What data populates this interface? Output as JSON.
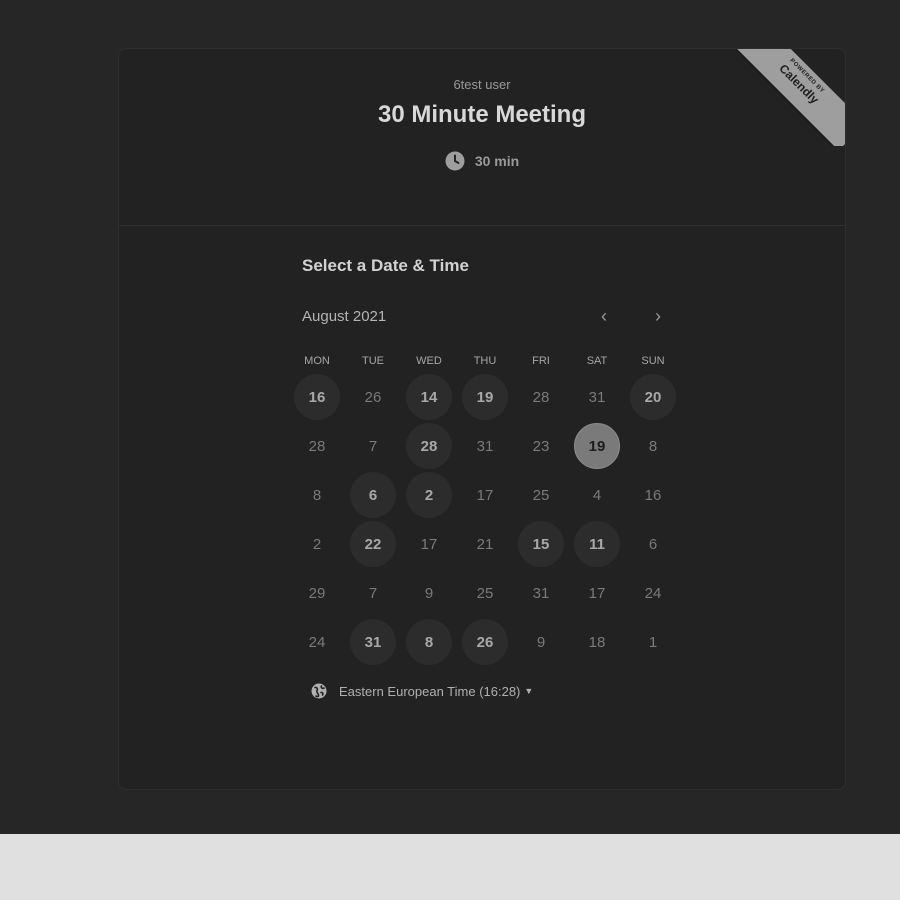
{
  "ribbon": {
    "small": "POWERED BY",
    "brand": "Calendly"
  },
  "event": {
    "host": "6test user",
    "title": "30 Minute Meeting",
    "duration": "30 min"
  },
  "scheduler": {
    "section_title": "Select a Date & Time",
    "month_label": "August 2021",
    "prev_symbol": "‹",
    "next_symbol": "›"
  },
  "weekdays": [
    "MON",
    "TUE",
    "WED",
    "THU",
    "FRI",
    "SAT",
    "SUN"
  ],
  "weeks": [
    [
      {
        "d": "16",
        "s": "available"
      },
      {
        "d": "26",
        "s": "unavailable"
      },
      {
        "d": "14",
        "s": "available"
      },
      {
        "d": "19",
        "s": "available"
      },
      {
        "d": "28",
        "s": "unavailable"
      },
      {
        "d": "31",
        "s": "unavailable"
      },
      {
        "d": "20",
        "s": "available"
      }
    ],
    [
      {
        "d": "28",
        "s": "unavailable"
      },
      {
        "d": "7",
        "s": "unavailable"
      },
      {
        "d": "28",
        "s": "available"
      },
      {
        "d": "31",
        "s": "unavailable"
      },
      {
        "d": "23",
        "s": "unavailable"
      },
      {
        "d": "19",
        "s": "selected"
      },
      {
        "d": "8",
        "s": "unavailable"
      }
    ],
    [
      {
        "d": "8",
        "s": "unavailable"
      },
      {
        "d": "6",
        "s": "available"
      },
      {
        "d": "2",
        "s": "available"
      },
      {
        "d": "17",
        "s": "unavailable"
      },
      {
        "d": "25",
        "s": "unavailable"
      },
      {
        "d": "4",
        "s": "unavailable"
      },
      {
        "d": "16",
        "s": "unavailable"
      }
    ],
    [
      {
        "d": "2",
        "s": "unavailable"
      },
      {
        "d": "22",
        "s": "available"
      },
      {
        "d": "17",
        "s": "unavailable"
      },
      {
        "d": "21",
        "s": "unavailable"
      },
      {
        "d": "15",
        "s": "available"
      },
      {
        "d": "11",
        "s": "available"
      },
      {
        "d": "6",
        "s": "unavailable"
      }
    ],
    [
      {
        "d": "29",
        "s": "unavailable"
      },
      {
        "d": "7",
        "s": "unavailable"
      },
      {
        "d": "9",
        "s": "unavailable"
      },
      {
        "d": "25",
        "s": "unavailable"
      },
      {
        "d": "31",
        "s": "unavailable"
      },
      {
        "d": "17",
        "s": "unavailable"
      },
      {
        "d": "24",
        "s": "unavailable"
      }
    ],
    [
      {
        "d": "24",
        "s": "unavailable"
      },
      {
        "d": "31",
        "s": "available"
      },
      {
        "d": "8",
        "s": "available"
      },
      {
        "d": "26",
        "s": "available"
      },
      {
        "d": "9",
        "s": "unavailable"
      },
      {
        "d": "18",
        "s": "unavailable"
      },
      {
        "d": "1",
        "s": "unavailable"
      }
    ]
  ],
  "timezone": {
    "label": "Eastern European Time (16:28)"
  },
  "colors": {
    "page_bg": "#262626",
    "card_bg": "#222222",
    "selected": "#7a7a7a",
    "available_bg": "#2c2c2c",
    "ribbon": "#9e9e9e"
  }
}
